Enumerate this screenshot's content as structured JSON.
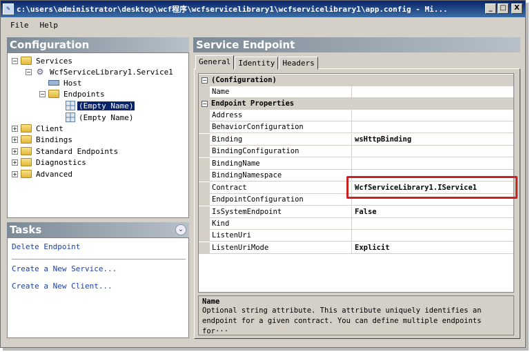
{
  "window": {
    "title": "c:\\users\\administrator\\desktop\\wcf程序\\wcfservicelibrary1\\wcfservicelibrary1\\app.config - Mi...",
    "minimize": "_",
    "maximize": "□",
    "close": "X"
  },
  "menu": {
    "file": "File",
    "help": "Help"
  },
  "configuration": {
    "header": "Configuration",
    "tree": {
      "services": "Services",
      "service1": "WcfServiceLibrary1.Service1",
      "host": "Host",
      "endpoints": "Endpoints",
      "endpoint1": "(Empty Name)",
      "endpoint2": "(Empty Name)",
      "client": "Client",
      "bindings": "Bindings",
      "standard_endpoints": "Standard Endpoints",
      "diagnostics": "Diagnostics",
      "advanced": "Advanced"
    }
  },
  "tasks": {
    "header": "Tasks",
    "collapse": "⌄",
    "delete_endpoint": "Delete Endpoint",
    "create_service": "Create a New Service...",
    "create_client": "Create a New Client..."
  },
  "endpoint": {
    "header": "Service Endpoint",
    "tabs": {
      "general": "General",
      "identity": "Identity",
      "headers": "Headers"
    },
    "cat_configuration": "(Configuration)",
    "cat_endpoint_properties": "Endpoint Properties",
    "props": {
      "name": {
        "label": "Name",
        "value": ""
      },
      "address": {
        "label": "Address",
        "value": ""
      },
      "behavior": {
        "label": "BehaviorConfiguration",
        "value": ""
      },
      "binding": {
        "label": "Binding",
        "value": "wsHttpBinding"
      },
      "binding_config": {
        "label": "BindingConfiguration",
        "value": ""
      },
      "binding_name": {
        "label": "BindingName",
        "value": ""
      },
      "binding_ns": {
        "label": "BindingNamespace",
        "value": ""
      },
      "contract": {
        "label": "Contract",
        "value": "WcfServiceLibrary1.IService1"
      },
      "endpoint_config": {
        "label": "EndpointConfiguration",
        "value": ""
      },
      "is_system": {
        "label": "IsSystemEndpoint",
        "value": "False"
      },
      "kind": {
        "label": "Kind",
        "value": ""
      },
      "listen_uri": {
        "label": "ListenUri",
        "value": ""
      },
      "listen_uri_mode": {
        "label": "ListenUriMode",
        "value": "Explicit"
      }
    },
    "description": {
      "title": "Name",
      "line1": "Optional string attribute. This attribute uniquely identifies an",
      "line2": "endpoint for a given contract. You can define multiple endpoints for···"
    }
  },
  "colors": {
    "selection": "#0a246a",
    "highlight": "#d21f1f",
    "link": "#1a3fa8"
  }
}
